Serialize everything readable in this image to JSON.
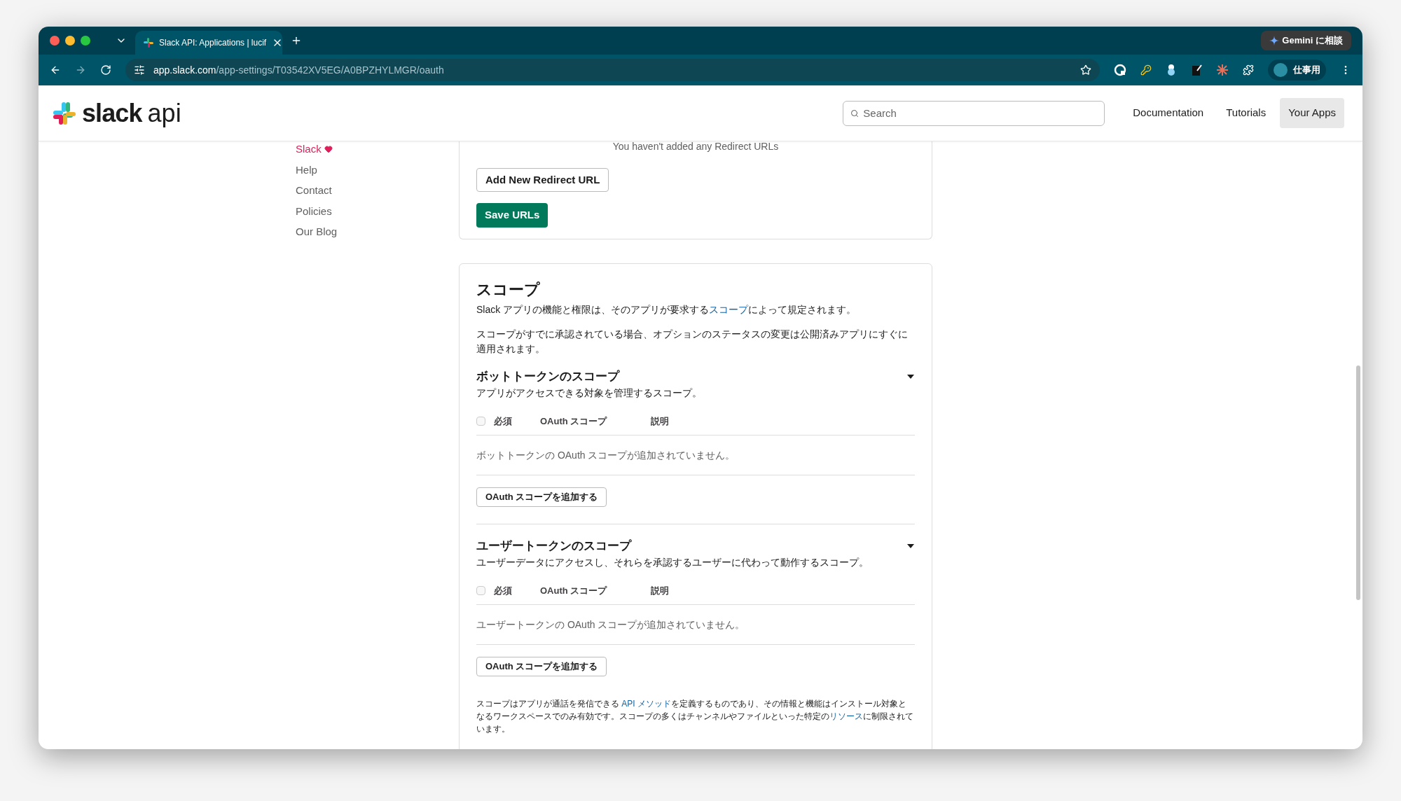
{
  "browser": {
    "tab": {
      "title": "Slack API: Applications | lucif",
      "selected": true
    },
    "url_host": "app.slack.com",
    "url_path": "/app-settings/T03542XV5EG/A0BPZHYLMGR/oauth",
    "gemini": "Gemini に相談",
    "profile": "仕事用"
  },
  "header": {
    "logo_word": "slack",
    "logo_suffix": "api",
    "search": {
      "placeholder": "Search"
    },
    "nav": [
      {
        "label": "Documentation",
        "selected": false
      },
      {
        "label": "Tutorials",
        "selected": false
      },
      {
        "label": "Your Apps",
        "selected": true
      }
    ]
  },
  "sidebar": {
    "links": [
      {
        "label": "Slack",
        "kind": "heart"
      },
      {
        "label": "Help",
        "kind": "plain"
      },
      {
        "label": "Contact",
        "kind": "plain"
      },
      {
        "label": "Policies",
        "kind": "plain"
      },
      {
        "label": "Our Blog",
        "kind": "plain"
      }
    ]
  },
  "redirect": {
    "empty_text": "You haven't added any Redirect URLs",
    "add_button": "Add New Redirect URL",
    "save_button": "Save URLs"
  },
  "scopes": {
    "title": "スコープ",
    "intro": {
      "before": "Slack アプリの機能と権限は、そのアプリが要求する",
      "link": "スコープ",
      "after": "によって規定されます。"
    },
    "note": "スコープがすでに承認されている場合、オプションのステータスの変更は公開済みアプリにすぐに適用されます。",
    "sections": [
      {
        "title": "ボットトークンのスコープ",
        "subtitle": "アプリがアクセスできる対象を管理するスコープ。",
        "expanded": true,
        "checked": false,
        "columns": [
          "必須",
          "OAuth スコープ",
          "説明"
        ],
        "empty_text": "ボットトークンの OAuth スコープが追加されていません。",
        "add_button": "OAuth スコープを追加する"
      },
      {
        "title": "ユーザートークンのスコープ",
        "subtitle": "ユーザーデータにアクセスし、それらを承認するユーザーに代わって動作するスコープ。",
        "expanded": true,
        "checked": false,
        "columns": [
          "必須",
          "OAuth スコープ",
          "説明"
        ],
        "empty_text": "ユーザートークンの OAuth スコープが追加されていません。",
        "add_button": "OAuth スコープを追加する"
      }
    ],
    "footer": {
      "before": "スコープはアプリが通話を発信できる ",
      "link1": "API メソッド",
      "middle": "を定義するものであり、その情報と機能はインストール対象となるワークスペースでのみ有効です。スコープの多くはチャンネルやファイルといった特定の",
      "link2": "リソース",
      "after": "に制限されています。"
    }
  }
}
